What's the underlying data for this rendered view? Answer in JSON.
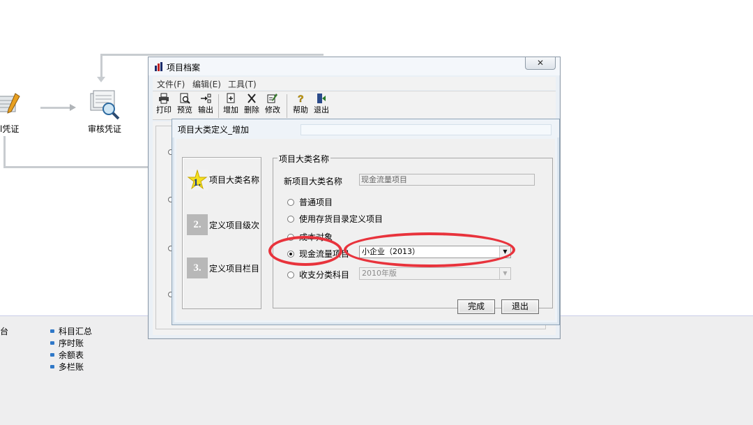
{
  "background": {
    "flow_nodes": [
      {
        "label": "填制凭证",
        "visible_text": "l凭证"
      },
      {
        "label": "审核凭证"
      }
    ],
    "bottom_links": [
      "科目汇总",
      "序时账",
      "余额表",
      "多栏账"
    ],
    "left_edge_text": "台"
  },
  "window": {
    "title": "项目档案",
    "close_symbol": "✕",
    "menu": [
      "文件(F)",
      "编辑(E)",
      "工具(T)"
    ],
    "toolbar": [
      {
        "label": "打印",
        "icon": "printer-icon"
      },
      {
        "label": "预览",
        "icon": "preview-icon"
      },
      {
        "label": "输出",
        "icon": "export-icon"
      },
      {
        "label": "增加",
        "icon": "add-icon"
      },
      {
        "label": "删除",
        "icon": "delete-icon"
      },
      {
        "label": "修改",
        "icon": "edit-icon"
      },
      {
        "label": "帮助",
        "icon": "help-icon"
      },
      {
        "label": "退出",
        "icon": "exit-icon"
      }
    ]
  },
  "dialog": {
    "title": "项目大类定义_增加",
    "steps": [
      {
        "num": "1.",
        "label": "项目大类名称",
        "active": true
      },
      {
        "num": "2.",
        "label": "定义项目级次",
        "active": false
      },
      {
        "num": "3.",
        "label": "定义项目栏目",
        "active": false
      }
    ],
    "group_title": "项目大类名称",
    "new_name_label": "新项目大类名称",
    "new_name_value": "现金流量项目",
    "options": [
      {
        "label": "普通项目",
        "selected": false
      },
      {
        "label": "使用存货目录定义项目",
        "selected": false
      },
      {
        "label": "成本对象",
        "selected": false
      },
      {
        "label": "现金流量项目",
        "selected": true
      },
      {
        "label": "收支分类科目",
        "selected": false
      }
    ],
    "cashflow_select": "小企业（2013）",
    "income_select": "2010年版",
    "finish_button": "完成",
    "exit_button": "退出"
  },
  "colors": {
    "annotation_red": "#e8333c",
    "window_bg": "#eaf0f6",
    "panel_bg": "#f0f0f0"
  }
}
